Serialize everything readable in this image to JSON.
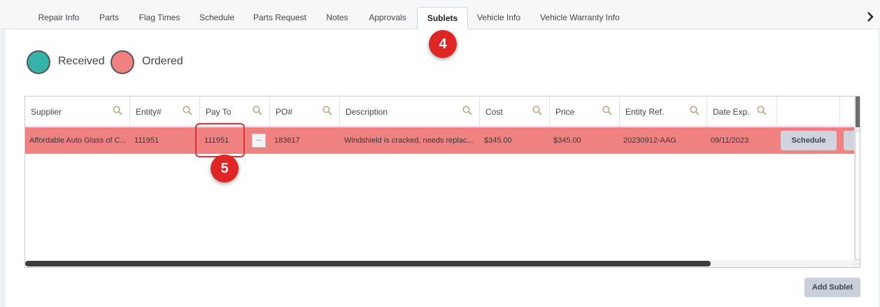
{
  "tabs": [
    {
      "label": "Repair Info",
      "active": false
    },
    {
      "label": "Parts",
      "active": false
    },
    {
      "label": "Flag Times",
      "active": false
    },
    {
      "label": "Schedule",
      "active": false
    },
    {
      "label": "Parts Request",
      "active": false
    },
    {
      "label": "Notes",
      "active": false
    },
    {
      "label": "Approvals",
      "active": false
    },
    {
      "label": "Sublets",
      "active": true
    },
    {
      "label": "Vehicle Info",
      "active": false
    },
    {
      "label": "Vehicle Warranty Info",
      "active": false
    }
  ],
  "tab_scroll_icon": "chevron-right-icon",
  "legend": [
    {
      "label": "Received",
      "color": "#35b3a8"
    },
    {
      "label": "Ordered",
      "color": "#ef8181"
    }
  ],
  "grid": {
    "columns": [
      "Supplier",
      "Entity#",
      "Pay To",
      "PO#",
      "Description",
      "Cost",
      "Price",
      "Entity Ref.",
      "Date Exp."
    ],
    "rows": [
      {
        "supplier": "Affordable Auto Glass of C...",
        "entity": "111951",
        "pay_to": "111951",
        "po": "183617",
        "description": "Windshield is cracked, needs replac...",
        "cost": "$345.00",
        "price": "$345.00",
        "entity_ref": "20230912-AAG",
        "date_exp": "09/11/2023",
        "ellipsis_label": "...",
        "schedule_label": "Schedule",
        "status_color": "#ef8181"
      }
    ]
  },
  "add_sublet_label": "Add Sublet",
  "callouts": [
    {
      "label": "4"
    },
    {
      "label": "5"
    }
  ]
}
